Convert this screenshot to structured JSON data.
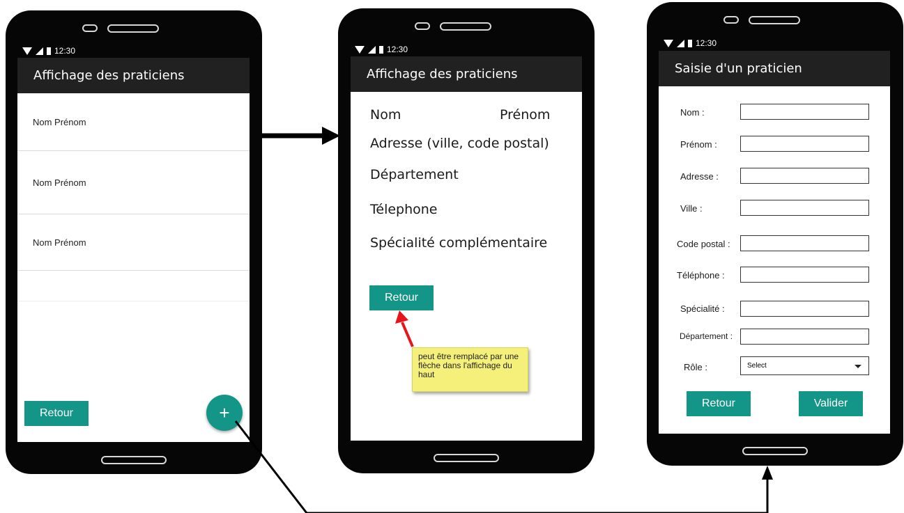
{
  "status_bar": {
    "time": "12:30"
  },
  "screen_list": {
    "title": "Affichage des praticiens",
    "items": [
      "Nom Prénom",
      "Nom Prénom",
      "Nom Prénom"
    ],
    "back_label": "Retour",
    "fab_label": "+"
  },
  "screen_detail": {
    "title": "Affichage des praticiens",
    "nom": "Nom",
    "prenom": "Prénom",
    "adresse": "Adresse (ville, code postal)",
    "departement": "Département",
    "telephone": "Télephone",
    "specialite": "Spécialité complémentaire",
    "back_label": "Retour",
    "note": "peut être remplacé par une flèche dans l'affichage du haut"
  },
  "screen_form": {
    "title": "Saisie d'un praticien",
    "fields": [
      {
        "label": "Nom :",
        "value": ""
      },
      {
        "label": "Prénom :",
        "value": ""
      },
      {
        "label": "Adresse :",
        "value": ""
      },
      {
        "label": "Ville :",
        "value": ""
      },
      {
        "label": "Code postal :",
        "value": ""
      },
      {
        "label": "Téléphone :",
        "value": ""
      },
      {
        "label": "Spécialité :",
        "value": ""
      },
      {
        "label": "Département :",
        "value": ""
      }
    ],
    "role_label": "Rôle :",
    "role_selected": "Select",
    "back_label": "Retour",
    "submit_label": "Valider"
  },
  "colors": {
    "accent": "#139587",
    "appbar": "#212121",
    "phone": "#060606",
    "note_bg": "#f5f07a",
    "annotation_arrow": "#e8141c"
  }
}
